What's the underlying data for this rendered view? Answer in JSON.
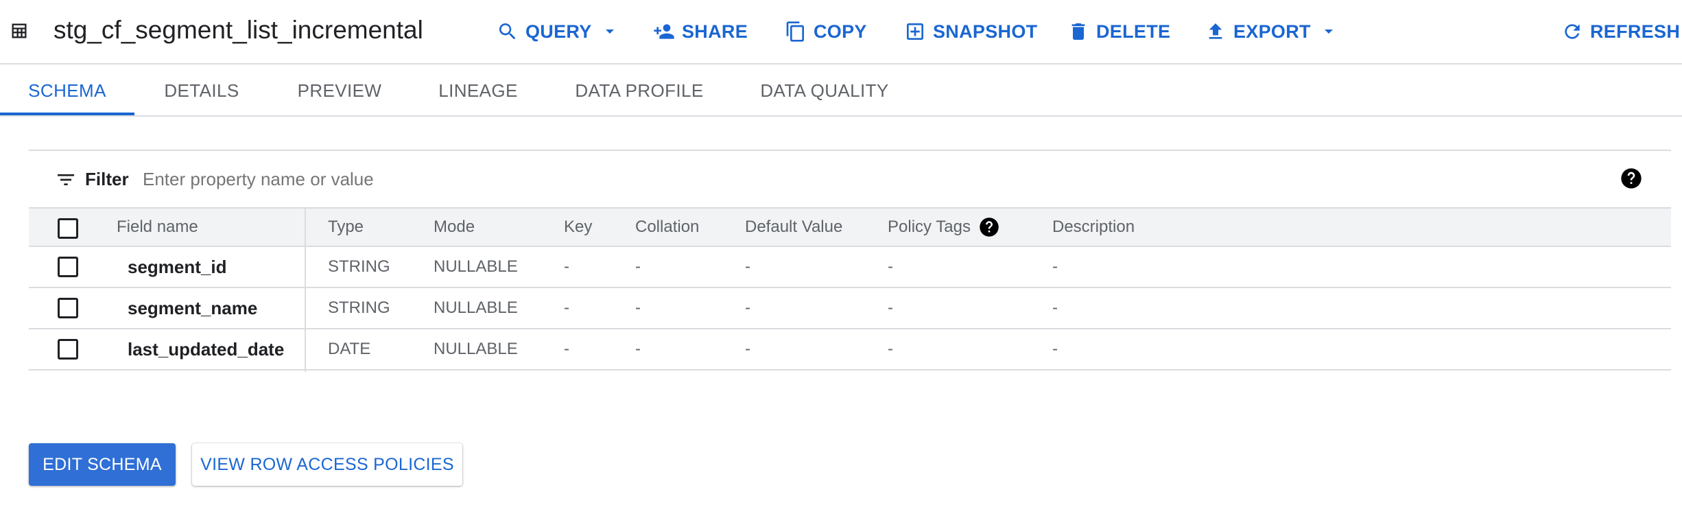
{
  "header": {
    "title": "stg_cf_segment_list_incremental",
    "actions": {
      "query": "QUERY",
      "share": "SHARE",
      "copy": "COPY",
      "snapshot": "SNAPSHOT",
      "delete": "DELETE",
      "export": "EXPORT",
      "refresh": "REFRESH"
    }
  },
  "tabs": [
    {
      "label": "SCHEMA",
      "active": true
    },
    {
      "label": "DETAILS",
      "active": false
    },
    {
      "label": "PREVIEW",
      "active": false
    },
    {
      "label": "LINEAGE",
      "active": false
    },
    {
      "label": "DATA PROFILE",
      "active": false
    },
    {
      "label": "DATA QUALITY",
      "active": false
    }
  ],
  "filter": {
    "label": "Filter",
    "placeholder": "Enter property name or value"
  },
  "schema": {
    "columns": [
      "Field name",
      "Type",
      "Mode",
      "Key",
      "Collation",
      "Default Value",
      "Policy Tags",
      "Description"
    ],
    "rows": [
      {
        "field": "segment_id",
        "type": "STRING",
        "mode": "NULLABLE",
        "key": "-",
        "collation": "-",
        "default": "-",
        "policy": "-",
        "description": "-"
      },
      {
        "field": "segment_name",
        "type": "STRING",
        "mode": "NULLABLE",
        "key": "-",
        "collation": "-",
        "default": "-",
        "policy": "-",
        "description": "-"
      },
      {
        "field": "last_updated_date",
        "type": "DATE",
        "mode": "NULLABLE",
        "key": "-",
        "collation": "-",
        "default": "-",
        "policy": "-",
        "description": "-"
      }
    ]
  },
  "buttons": {
    "edit_schema": "EDIT SCHEMA",
    "view_row_access": "VIEW ROW ACCESS POLICIES"
  },
  "colors": {
    "accent": "#1a66d2",
    "primary_button": "#2f6fd6",
    "divider": "#dadce0",
    "header_row_bg": "#f1f3f4"
  },
  "icons": {
    "table": "table-icon",
    "query": "search-icon",
    "share": "person-add-icon",
    "copy": "copy-icon",
    "snapshot": "snapshot-icon",
    "delete": "trash-icon",
    "export": "upload-icon",
    "refresh": "refresh-icon",
    "filter": "filter-icon",
    "help": "help-icon"
  }
}
